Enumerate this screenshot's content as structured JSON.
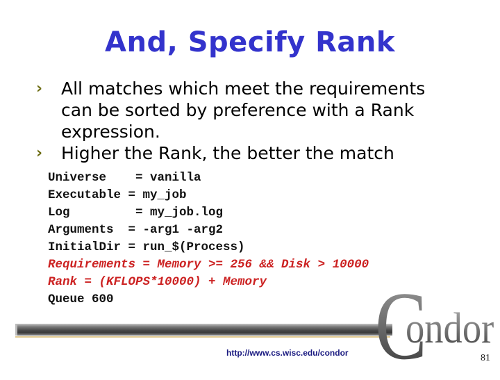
{
  "slide": {
    "title": "And, Specify Rank",
    "bullets": [
      {
        "marker": "›",
        "lines": [
          "All matches which meet the requirements",
          "can be sorted by preference with a Rank",
          "expression."
        ]
      },
      {
        "marker": "›",
        "lines": [
          "Higher the Rank, the better the match"
        ]
      }
    ],
    "code": [
      {
        "text": "Universe    = vanilla",
        "highlight": false
      },
      {
        "text": "Executable = my_job",
        "highlight": false
      },
      {
        "text": "Log         = my_job.log",
        "highlight": false
      },
      {
        "text": "Arguments  = -arg1 -arg2",
        "highlight": false
      },
      {
        "text": "InitialDir = run_$(Process)",
        "highlight": false
      },
      {
        "text": "Requirements = Memory >= 256 && Disk > 10000",
        "highlight": true
      },
      {
        "text": "Rank = (KFLOPS*10000) + Memory",
        "highlight": true
      },
      {
        "text": "Queue 600",
        "highlight": false
      }
    ],
    "footer": {
      "url": "http://www.cs.wisc.edu/condor",
      "logo_initial": "C",
      "logo_rest": "ondor",
      "page_number": "81"
    },
    "colors": {
      "title": "#3333cc",
      "bullet_marker": "#6b6b10",
      "highlight_code": "#cc2222",
      "url": "#1a1a80"
    }
  }
}
